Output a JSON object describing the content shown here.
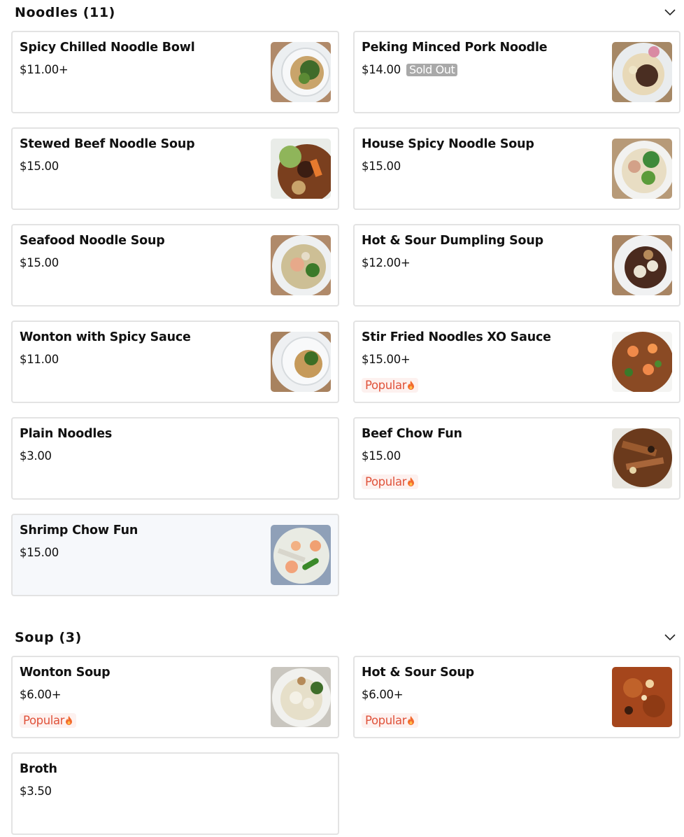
{
  "sections": [
    {
      "title": "Noodles (11)",
      "items": [
        {
          "name": "Spicy Chilled Noodle Bowl",
          "price": "$11.00+",
          "image": "noodle-bowl-photo"
        },
        {
          "name": "Peking Minced Pork Noodle",
          "price": "$14.00",
          "badge": "Sold Out",
          "image": "noodle-bowl-photo"
        },
        {
          "name": "Stewed Beef Noodle Soup",
          "price": "$15.00",
          "image": "beef-soup-photo"
        },
        {
          "name": "House Spicy Noodle Soup",
          "price": "$15.00",
          "image": "spicy-soup-photo"
        },
        {
          "name": "Seafood Noodle Soup",
          "price": "$15.00",
          "image": "seafood-soup-photo"
        },
        {
          "name": "Hot & Sour Dumpling Soup",
          "price": "$12.00+",
          "image": "dumpling-soup-photo"
        },
        {
          "name": "Wonton with Spicy Sauce",
          "price": "$11.00",
          "image": "wonton-photo"
        },
        {
          "name": "Stir Fried Noodles XO Sauce",
          "price": "$15.00+",
          "tag": "Popular",
          "image": "xo-noodles-photo"
        },
        {
          "name": "Plain Noodles",
          "price": "$3.00"
        },
        {
          "name": "Beef Chow Fun",
          "price": "$15.00",
          "tag": "Popular",
          "image": "chow-fun-photo"
        },
        {
          "name": "Shrimp Chow Fun",
          "price": "$15.00",
          "image": "shrimp-chow-fun-photo"
        }
      ]
    },
    {
      "title": "Soup (3)",
      "items": [
        {
          "name": "Wonton Soup",
          "price": "$6.00+",
          "tag": "Popular",
          "image": "wonton-soup-photo"
        },
        {
          "name": "Hot & Sour Soup",
          "price": "$6.00+",
          "tag": "Popular",
          "image": "hot-sour-soup-photo"
        },
        {
          "name": "Broth",
          "price": "$3.50"
        }
      ]
    }
  ],
  "colors": {
    "popular_text": "#e0533b",
    "popular_bg": "#fdf1ef",
    "sold_out_bg": "#a9a9a9",
    "card_border": "#e3e3e3"
  }
}
